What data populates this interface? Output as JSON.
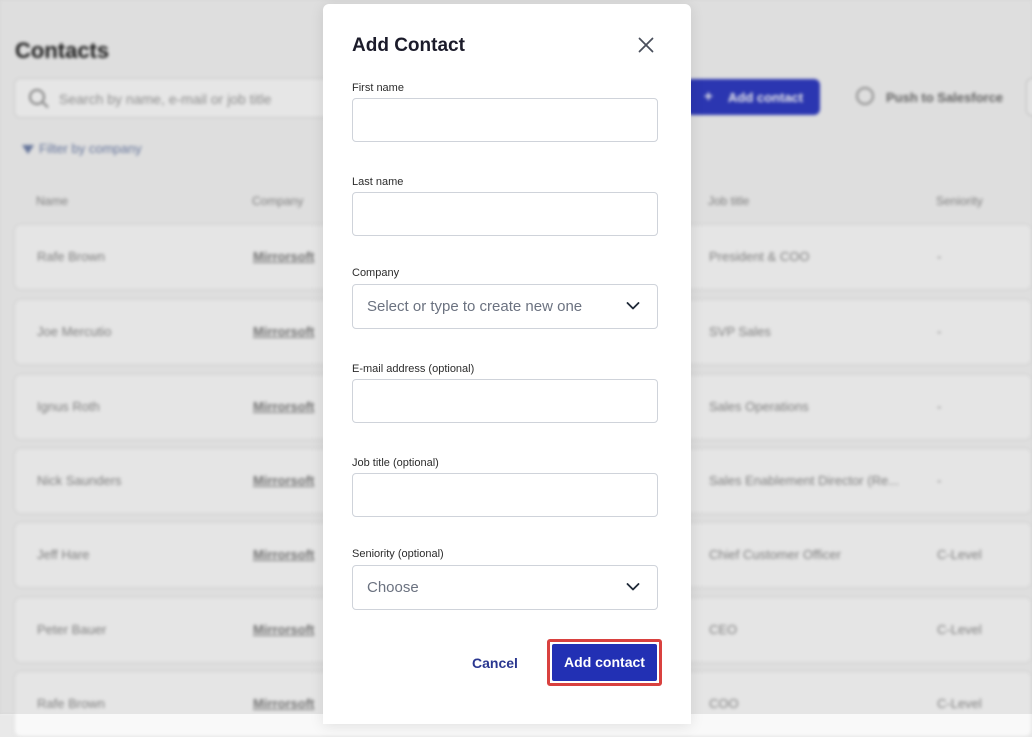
{
  "background": {
    "page_title": "Contacts",
    "search_placeholder": "Search by name, e-mail or job title",
    "add_contact_label": "Add contact",
    "push_label": "Push to Salesforce",
    "filter_label": "Filter by company",
    "columns": [
      "Name",
      "Company",
      "Job title",
      "Seniority"
    ],
    "rows": [
      {
        "name": "Rafe Brown",
        "company": "Mirrorsoft",
        "job_title": "President & COO",
        "seniority": "-"
      },
      {
        "name": "Joe Mercutio",
        "company": "Mirrorsoft",
        "job_title": "SVP Sales",
        "seniority": "-"
      },
      {
        "name": "Ignus Roth",
        "company": "Mirrorsoft",
        "job_title": "Sales Operations",
        "seniority": "-"
      },
      {
        "name": "Nick Saunders",
        "company": "Mirrorsoft",
        "job_title": "Sales Enablement Director (Re...",
        "seniority": "-"
      },
      {
        "name": "Jeff Hare",
        "company": "Mirrorsoft",
        "job_title": "Chief Customer Officer",
        "seniority": "C-Level"
      },
      {
        "name": "Peter Bauer",
        "company": "Mirrorsoft",
        "job_title": "CEO",
        "seniority": "C-Level"
      },
      {
        "name": "Rafe Brown",
        "company": "Mirrorsoft",
        "job_title": "COO",
        "seniority": "C-Level"
      }
    ]
  },
  "modal": {
    "title": "Add Contact",
    "first_name": {
      "label": "First name",
      "value": ""
    },
    "last_name": {
      "label": "Last name",
      "value": ""
    },
    "company": {
      "label": "Company",
      "placeholder": "Select or type to create new one"
    },
    "email": {
      "label": "E-mail address (optional)",
      "value": ""
    },
    "job_title": {
      "label": "Job title (optional)",
      "value": ""
    },
    "seniority": {
      "label": "Seniority (optional)",
      "placeholder": "Choose"
    },
    "cancel_label": "Cancel",
    "submit_label": "Add contact"
  },
  "colors": {
    "primary": "#2230b4",
    "highlight_border": "#d9413f",
    "cancel_text": "#2a3790"
  },
  "icons": {
    "close": "close-icon",
    "dropdown": "chevron-down-icon",
    "search": "search-icon",
    "filter": "filter-icon",
    "sync": "sync-icon"
  }
}
